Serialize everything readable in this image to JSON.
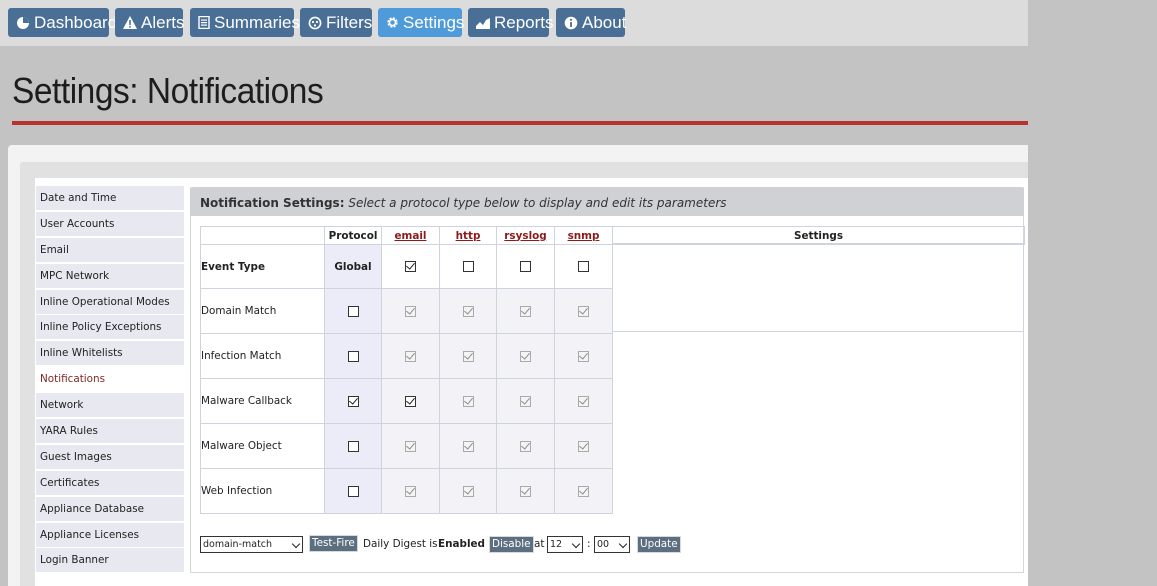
{
  "nav": {
    "items": [
      {
        "label": "Dashboard",
        "icon": "pie-chart-icon"
      },
      {
        "label": "Alerts",
        "icon": "warning-icon"
      },
      {
        "label": "Summaries",
        "icon": "document-icon"
      },
      {
        "label": "Filters",
        "icon": "filter-icon"
      },
      {
        "label": "Settings",
        "icon": "gear-icon",
        "active": true
      },
      {
        "label": "Reports",
        "icon": "area-chart-icon"
      },
      {
        "label": "About",
        "icon": "info-icon"
      }
    ]
  },
  "page": {
    "title": "Settings: Notifications"
  },
  "sidebar": {
    "items": [
      {
        "label": "Date and Time"
      },
      {
        "label": "User Accounts"
      },
      {
        "label": "Email"
      },
      {
        "label": "MPC Network"
      },
      {
        "label": "Inline Operational Modes"
      },
      {
        "label": "Inline Policy Exceptions"
      },
      {
        "label": "Inline Whitelists"
      },
      {
        "label": "Notifications",
        "active": true
      },
      {
        "label": "Network"
      },
      {
        "label": "YARA Rules"
      },
      {
        "label": "Guest Images"
      },
      {
        "label": "Certificates"
      },
      {
        "label": "Appliance Database"
      },
      {
        "label": "Appliance Licenses"
      },
      {
        "label": "Login Banner"
      }
    ]
  },
  "main": {
    "header_bold": "Notification Settings:",
    "header_italic": "Select a protocol type below to display and edit its parameters",
    "table": {
      "col_protocol": "Protocol",
      "protocols": [
        "email",
        "http",
        "rsyslog",
        "snmp"
      ],
      "col_settings": "Settings",
      "event_type_label": "Event Type",
      "global_label": "Global",
      "protocol_enabled": [
        true,
        false,
        false,
        false
      ],
      "rows": [
        {
          "label": "Domain Match",
          "global": false,
          "protocols": [
            true,
            true,
            true,
            true
          ]
        },
        {
          "label": "Infection Match",
          "global": false,
          "protocols": [
            true,
            true,
            true,
            true
          ]
        },
        {
          "label": "Malware Callback",
          "global": true,
          "protocols": [
            true,
            true,
            true,
            true
          ]
        },
        {
          "label": "Malware Object",
          "global": false,
          "protocols": [
            true,
            true,
            true,
            true
          ]
        },
        {
          "label": "Web Infection",
          "global": false,
          "protocols": [
            true,
            true,
            true,
            true
          ]
        }
      ]
    },
    "controls": {
      "event_select": "domain-match",
      "test_fire": "Test-Fire",
      "digest_prefix": "Daily Digest is",
      "digest_status": "Enabled",
      "disable": "Disable",
      "at": "at",
      "hour": "12",
      "colon": ":",
      "minute": "00",
      "update": "Update"
    }
  }
}
